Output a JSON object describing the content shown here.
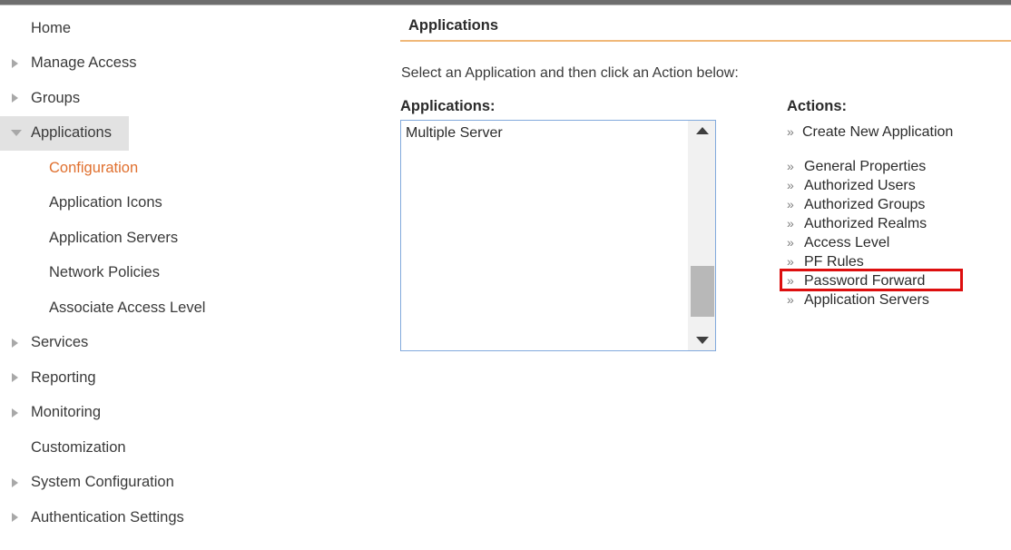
{
  "sidebar": {
    "items": [
      {
        "label": "Home",
        "arrow": "none",
        "level": 0,
        "state": "normal"
      },
      {
        "label": "Manage Access",
        "arrow": "collapsed",
        "level": 0,
        "state": "normal"
      },
      {
        "label": "Groups",
        "arrow": "collapsed",
        "level": 0,
        "state": "normal"
      },
      {
        "label": "Applications",
        "arrow": "expanded",
        "level": 0,
        "state": "expanded"
      },
      {
        "label": "Configuration",
        "arrow": "none",
        "level": 1,
        "state": "active"
      },
      {
        "label": "Application Icons",
        "arrow": "none",
        "level": 1,
        "state": "normal"
      },
      {
        "label": "Application Servers",
        "arrow": "none",
        "level": 1,
        "state": "normal"
      },
      {
        "label": "Network Policies",
        "arrow": "none",
        "level": 1,
        "state": "normal"
      },
      {
        "label": "Associate Access Level",
        "arrow": "none",
        "level": 1,
        "state": "normal"
      },
      {
        "label": "Services",
        "arrow": "collapsed",
        "level": 0,
        "state": "normal"
      },
      {
        "label": "Reporting",
        "arrow": "collapsed",
        "level": 0,
        "state": "normal"
      },
      {
        "label": "Monitoring",
        "arrow": "collapsed",
        "level": 0,
        "state": "normal"
      },
      {
        "label": "Customization",
        "arrow": "none",
        "level": 0,
        "state": "normal"
      },
      {
        "label": "System Configuration",
        "arrow": "collapsed",
        "level": 0,
        "state": "normal"
      },
      {
        "label": "Authentication Settings",
        "arrow": "collapsed",
        "level": 0,
        "state": "normal"
      }
    ]
  },
  "content": {
    "title": "Applications",
    "instructions": "Select an Application and then click an Action below:",
    "applications": {
      "heading": "Applications:",
      "options": [
        "Multiple Server"
      ],
      "selected": "Multiple Server",
      "scroll_up_icon": "triangle-up-icon",
      "scroll_down_icon": "triangle-down-icon"
    },
    "actions": {
      "heading": "Actions:",
      "chevron": "»",
      "primary": "Create New Application",
      "items": [
        "General Properties",
        "Authorized Users",
        "Authorized Groups",
        "Authorized Realms",
        "Access Level",
        "PF Rules",
        "Password Forward",
        "Application Servers"
      ],
      "highlighted": "Password Forward"
    }
  },
  "colors": {
    "accent_orange": "#e0702f",
    "title_rule": "#f0b878",
    "highlight_red": "#dd0f0f",
    "listbox_border": "#82aadd",
    "sidebar_selected_bg": "#e2e2e2"
  }
}
